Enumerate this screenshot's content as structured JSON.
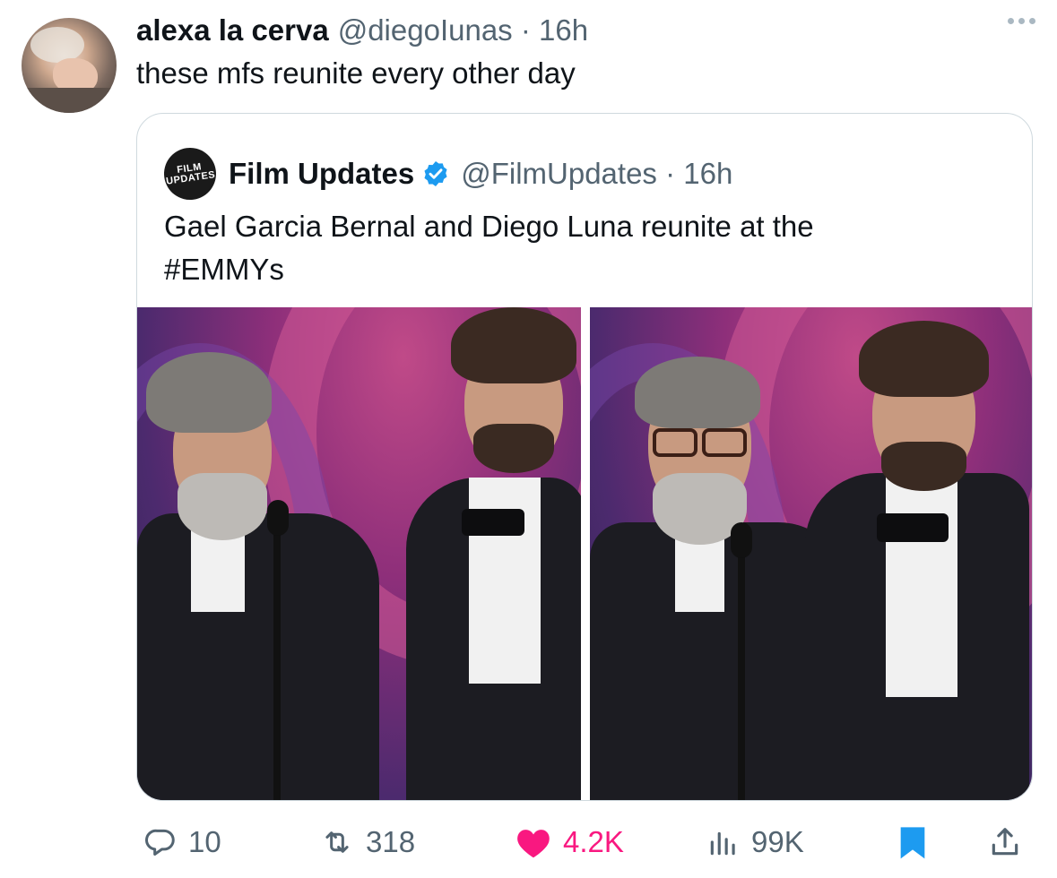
{
  "tweet": {
    "author_name": "alexa la cerva",
    "author_handle": "@diegoIunas",
    "time": "· 16h",
    "text": "these mfs reunite every other day"
  },
  "quote": {
    "logo_line1": "FILM",
    "logo_line2": "UPDATES",
    "author_name": "Film Updates",
    "author_handle": "@FilmUpdates",
    "time": "· 16h",
    "text_line1": "Gael Garcia Bernal and Diego Luna reunite at the",
    "text_line2": "#EMMYs"
  },
  "actions": {
    "replies": "10",
    "reposts": "318",
    "likes": "4.2K",
    "views": "99K"
  },
  "colors": {
    "like": "#f91880",
    "bookmark": "#1d9bf0",
    "verified": "#1d9bf0",
    "secondary_text": "#536471"
  },
  "icons": [
    "more-icon",
    "verified-icon",
    "reply-icon",
    "repost-icon",
    "like-icon",
    "views-icon",
    "bookmark-icon",
    "share-icon"
  ]
}
